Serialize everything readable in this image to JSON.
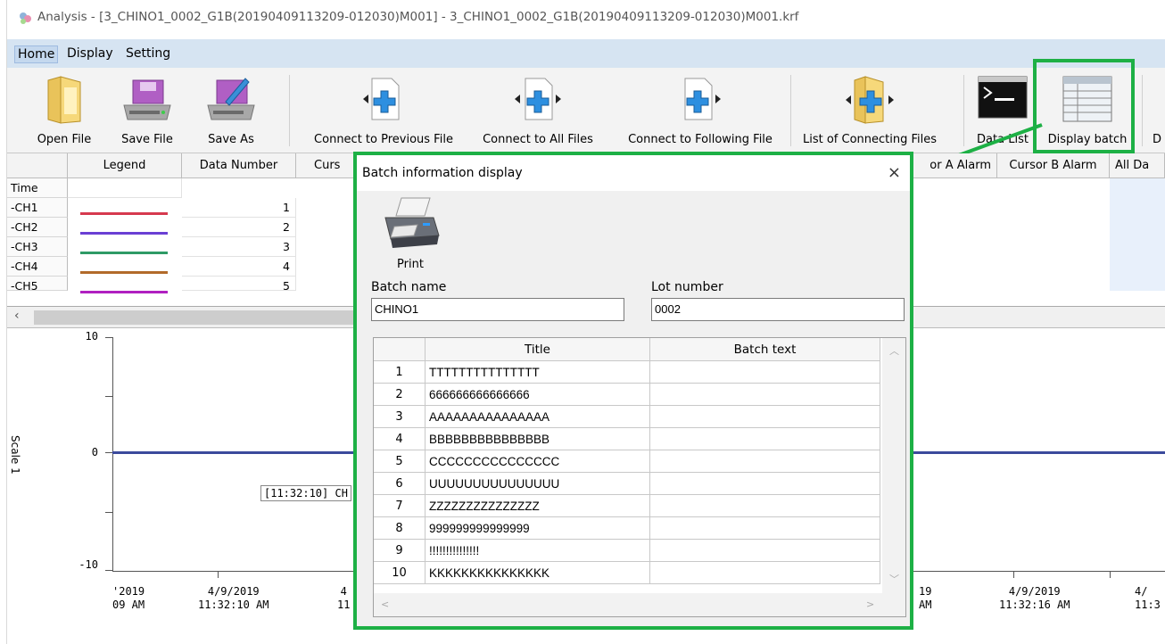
{
  "window": {
    "title": "Analysis - [3_CHINO1_0002_G1B(20190409113209-012030)M001] - 3_CHINO1_0002_G1B(20190409113209-012030)M001.krf"
  },
  "menu": {
    "items": [
      "Home",
      "Display",
      "Setting"
    ]
  },
  "ribbon": {
    "buttons": [
      {
        "label": "Open File",
        "icon": "folder-icon"
      },
      {
        "label": "Save File",
        "icon": "disk-icon"
      },
      {
        "label": "Save As",
        "icon": "disk-pen-icon"
      },
      {
        "label": "Connect to Previous File",
        "icon": "connect-previous-icon"
      },
      {
        "label": "Connect to All Files",
        "icon": "connect-all-icon"
      },
      {
        "label": "Connect to Following File",
        "icon": "connect-following-icon"
      },
      {
        "label": "List of Connecting Files",
        "icon": "folder-list-icon"
      },
      {
        "label": "Data List",
        "icon": "terminal-icon"
      },
      {
        "label": "Display batch",
        "icon": "table-icon"
      },
      {
        "label": "D",
        "icon": ""
      }
    ]
  },
  "legend_grid": {
    "headers": [
      "Legend",
      "Data Number",
      "Curs",
      "or A Alarm",
      "Cursor B Alarm",
      "All Da"
    ],
    "rows": [
      {
        "label": "Time",
        "number": "",
        "color": ""
      },
      {
        "label": "-CH1",
        "number": "1",
        "color": "#d6394f"
      },
      {
        "label": "-CH2",
        "number": "2",
        "color": "#6a3fd4"
      },
      {
        "label": "-CH3",
        "number": "3",
        "color": "#2e9a66"
      },
      {
        "label": "-CH4",
        "number": "4",
        "color": "#b26a2a"
      },
      {
        "label": "-CH5",
        "number": "5",
        "color": "#b020c0"
      }
    ]
  },
  "chart": {
    "scale_label": "Scale 1",
    "y_ticks": [
      "10",
      "0",
      "-10"
    ],
    "x_ticks": [
      {
        "date": "'2019",
        "time": "09 AM"
      },
      {
        "date": "4/9/2019",
        "time": "11:32:10 AM"
      },
      {
        "date": "4",
        "time": "11"
      },
      {
        "date": "19",
        "time": "AM"
      },
      {
        "date": "4/9/2019",
        "time": "11:32:16 AM"
      },
      {
        "date": "4/",
        "time": "11:3"
      }
    ],
    "marker_label": "[11:32:10] CH",
    "line_color": "#3b4a9c"
  },
  "dialog": {
    "title": "Batch information display",
    "print_label": "Print",
    "batch_name_label": "Batch name",
    "batch_name_value": "CHINO1",
    "lot_number_label": "Lot number",
    "lot_number_value": "0002",
    "columns": [
      "Title",
      "Batch text"
    ],
    "rows": [
      {
        "n": "1",
        "title": "TTTTTTTTTTTTTTT"
      },
      {
        "n": "2",
        "title": "666666666666666"
      },
      {
        "n": "3",
        "title": "AAAAAAAAAAAAAAA"
      },
      {
        "n": "4",
        "title": "BBBBBBBBBBBBBBB"
      },
      {
        "n": "5",
        "title": "CCCCCCCCCCCCCCC"
      },
      {
        "n": "6",
        "title": "UUUUUUUUUUUUUUU"
      },
      {
        "n": "7",
        "title": "ZZZZZZZZZZZZZZZ"
      },
      {
        "n": "8",
        "title": "999999999999999"
      },
      {
        "n": "9",
        "title": "!!!!!!!!!!!!!!!"
      },
      {
        "n": "10",
        "title": "KKKKKKKKKKKKKKK"
      }
    ],
    "close_glyph": "×"
  },
  "highlight_color": "#1db045"
}
